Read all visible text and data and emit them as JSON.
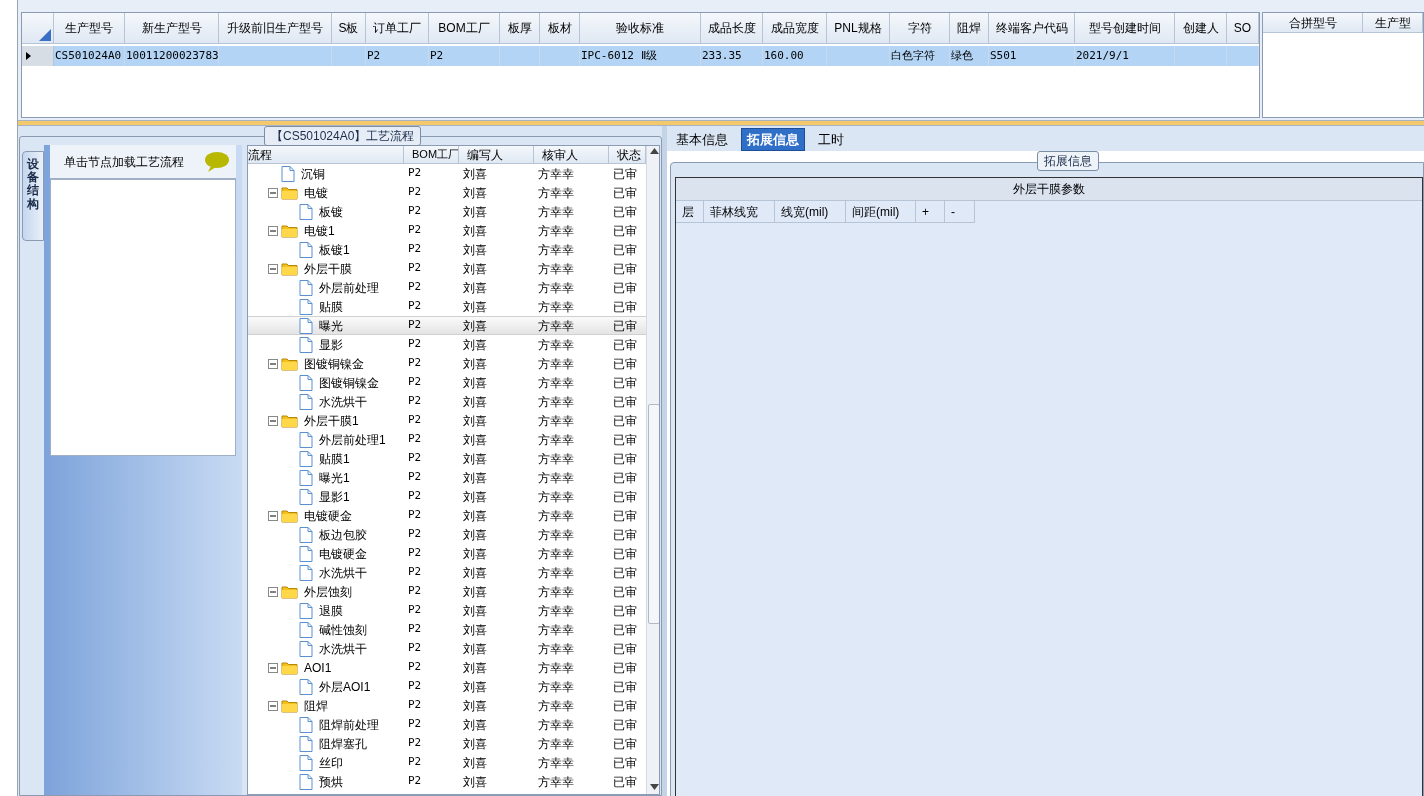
{
  "main_grid": {
    "columns": [
      "生产型号",
      "新生产型号",
      "升级前旧生产型号",
      "S板",
      "订单工厂",
      "BOM工厂",
      "板厚",
      "板材",
      "验收标准",
      "成品长度",
      "成品宽度",
      "PNL规格",
      "字符",
      "阻焊",
      "终端客户代码",
      "型号创建时间",
      "创建人",
      "SO"
    ],
    "rows": [
      {
        "selected": true,
        "cells": [
          "CS501024A0",
          "10011200023783",
          "",
          "",
          "P2",
          "P2",
          "",
          "",
          "IPC-6012 Ⅱ级",
          "233.35",
          "160.00",
          "",
          "白色字符",
          "绿色",
          "S501",
          "2021/9/1",
          "",
          ""
        ]
      }
    ]
  },
  "side_grid": {
    "columns": [
      "合拼型号",
      "生产型"
    ]
  },
  "process_panel": {
    "title": "【CS501024A0】工艺流程",
    "vertical_tab": "设备结构",
    "hint": "单击节点加载工艺流程",
    "tree_columns": [
      "流程",
      "BOM工厂",
      "编写人",
      "核审人",
      "状态"
    ],
    "tree": [
      {
        "kind": "file",
        "label": "沉铜",
        "bom": "P2",
        "writer": "刘喜",
        "reviewer": "方幸幸",
        "status": "已审",
        "selected": false
      },
      {
        "kind": "folder",
        "expanded": true,
        "label": "电镀",
        "bom": "P2",
        "writer": "刘喜",
        "reviewer": "方幸幸",
        "status": "已审",
        "selected": false,
        "children": [
          {
            "kind": "file",
            "label": "板镀",
            "bom": "P2",
            "writer": "刘喜",
            "reviewer": "方幸幸",
            "status": "已审",
            "selected": false
          }
        ]
      },
      {
        "kind": "folder",
        "expanded": true,
        "label": "电镀1",
        "bom": "P2",
        "writer": "刘喜",
        "reviewer": "方幸幸",
        "status": "已审",
        "selected": false,
        "children": [
          {
            "kind": "file",
            "label": "板镀1",
            "bom": "P2",
            "writer": "刘喜",
            "reviewer": "方幸幸",
            "status": "已审",
            "selected": false
          }
        ]
      },
      {
        "kind": "folder",
        "expanded": true,
        "label": "外层干膜",
        "bom": "P2",
        "writer": "刘喜",
        "reviewer": "方幸幸",
        "status": "已审",
        "selected": false,
        "children": [
          {
            "kind": "file",
            "label": "外层前处理",
            "bom": "P2",
            "writer": "刘喜",
            "reviewer": "方幸幸",
            "status": "已审",
            "selected": false
          },
          {
            "kind": "file",
            "label": "贴膜",
            "bom": "P2",
            "writer": "刘喜",
            "reviewer": "方幸幸",
            "status": "已审",
            "selected": false
          },
          {
            "kind": "file",
            "label": "曝光",
            "bom": "P2",
            "writer": "刘喜",
            "reviewer": "方幸幸",
            "status": "已审",
            "selected": true
          },
          {
            "kind": "file",
            "label": "显影",
            "bom": "P2",
            "writer": "刘喜",
            "reviewer": "方幸幸",
            "status": "已审",
            "selected": false
          }
        ]
      },
      {
        "kind": "folder",
        "expanded": true,
        "label": "图镀铜镍金",
        "bom": "P2",
        "writer": "刘喜",
        "reviewer": "方幸幸",
        "status": "已审",
        "selected": false,
        "children": [
          {
            "kind": "file",
            "label": "图镀铜镍金",
            "bom": "P2",
            "writer": "刘喜",
            "reviewer": "方幸幸",
            "status": "已审",
            "selected": false
          },
          {
            "kind": "file",
            "label": "水洗烘干",
            "bom": "P2",
            "writer": "刘喜",
            "reviewer": "方幸幸",
            "status": "已审",
            "selected": false
          }
        ]
      },
      {
        "kind": "folder",
        "expanded": true,
        "label": "外层干膜1",
        "bom": "P2",
        "writer": "刘喜",
        "reviewer": "方幸幸",
        "status": "已审",
        "selected": false,
        "children": [
          {
            "kind": "file",
            "label": "外层前处理1",
            "bom": "P2",
            "writer": "刘喜",
            "reviewer": "方幸幸",
            "status": "已审",
            "selected": false
          },
          {
            "kind": "file",
            "label": "贴膜1",
            "bom": "P2",
            "writer": "刘喜",
            "reviewer": "方幸幸",
            "status": "已审",
            "selected": false
          },
          {
            "kind": "file",
            "label": "曝光1",
            "bom": "P2",
            "writer": "刘喜",
            "reviewer": "方幸幸",
            "status": "已审",
            "selected": false
          },
          {
            "kind": "file",
            "label": "显影1",
            "bom": "P2",
            "writer": "刘喜",
            "reviewer": "方幸幸",
            "status": "已审",
            "selected": false
          }
        ]
      },
      {
        "kind": "folder",
        "expanded": true,
        "label": "电镀硬金",
        "bom": "P2",
        "writer": "刘喜",
        "reviewer": "方幸幸",
        "status": "已审",
        "selected": false,
        "children": [
          {
            "kind": "file",
            "label": "板边包胶",
            "bom": "P2",
            "writer": "刘喜",
            "reviewer": "方幸幸",
            "status": "已审",
            "selected": false
          },
          {
            "kind": "file",
            "label": "电镀硬金",
            "bom": "P2",
            "writer": "刘喜",
            "reviewer": "方幸幸",
            "status": "已审",
            "selected": false
          },
          {
            "kind": "file",
            "label": "水洗烘干",
            "bom": "P2",
            "writer": "刘喜",
            "reviewer": "方幸幸",
            "status": "已审",
            "selected": false
          }
        ]
      },
      {
        "kind": "folder",
        "expanded": true,
        "label": "外层蚀刻",
        "bom": "P2",
        "writer": "刘喜",
        "reviewer": "方幸幸",
        "status": "已审",
        "selected": false,
        "children": [
          {
            "kind": "file",
            "label": "退膜",
            "bom": "P2",
            "writer": "刘喜",
            "reviewer": "方幸幸",
            "status": "已审",
            "selected": false
          },
          {
            "kind": "file",
            "label": "碱性蚀刻",
            "bom": "P2",
            "writer": "刘喜",
            "reviewer": "方幸幸",
            "status": "已审",
            "selected": false
          },
          {
            "kind": "file",
            "label": "水洗烘干",
            "bom": "P2",
            "writer": "刘喜",
            "reviewer": "方幸幸",
            "status": "已审",
            "selected": false
          }
        ]
      },
      {
        "kind": "folder",
        "expanded": true,
        "label": "AOI1",
        "bom": "P2",
        "writer": "刘喜",
        "reviewer": "方幸幸",
        "status": "已审",
        "selected": false,
        "children": [
          {
            "kind": "file",
            "label": "外层AOI1",
            "bom": "P2",
            "writer": "刘喜",
            "reviewer": "方幸幸",
            "status": "已审",
            "selected": false
          }
        ]
      },
      {
        "kind": "folder",
        "expanded": true,
        "label": "阻焊",
        "bom": "P2",
        "writer": "刘喜",
        "reviewer": "方幸幸",
        "status": "已审",
        "selected": false,
        "children": [
          {
            "kind": "file",
            "label": "阻焊前处理",
            "bom": "P2",
            "writer": "刘喜",
            "reviewer": "方幸幸",
            "status": "已审",
            "selected": false
          },
          {
            "kind": "file",
            "label": "阻焊塞孔",
            "bom": "P2",
            "writer": "刘喜",
            "reviewer": "方幸幸",
            "status": "已审",
            "selected": false
          },
          {
            "kind": "file",
            "label": "丝印",
            "bom": "P2",
            "writer": "刘喜",
            "reviewer": "方幸幸",
            "status": "已审",
            "selected": false
          },
          {
            "kind": "file",
            "label": "预烘",
            "bom": "P2",
            "writer": "刘喜",
            "reviewer": "方幸幸",
            "status": "已审",
            "selected": false
          }
        ]
      }
    ]
  },
  "detail_panel": {
    "tabs": [
      {
        "label": "基本信息",
        "selected": false
      },
      {
        "label": "拓展信息",
        "selected": true
      },
      {
        "label": "工时",
        "selected": false
      }
    ],
    "group_title": "拓展信息",
    "table_title": "外层干膜参数",
    "columns": [
      "层",
      "菲林线宽",
      "线宽(mil)",
      "间距(mil)",
      "+",
      "-"
    ]
  }
}
